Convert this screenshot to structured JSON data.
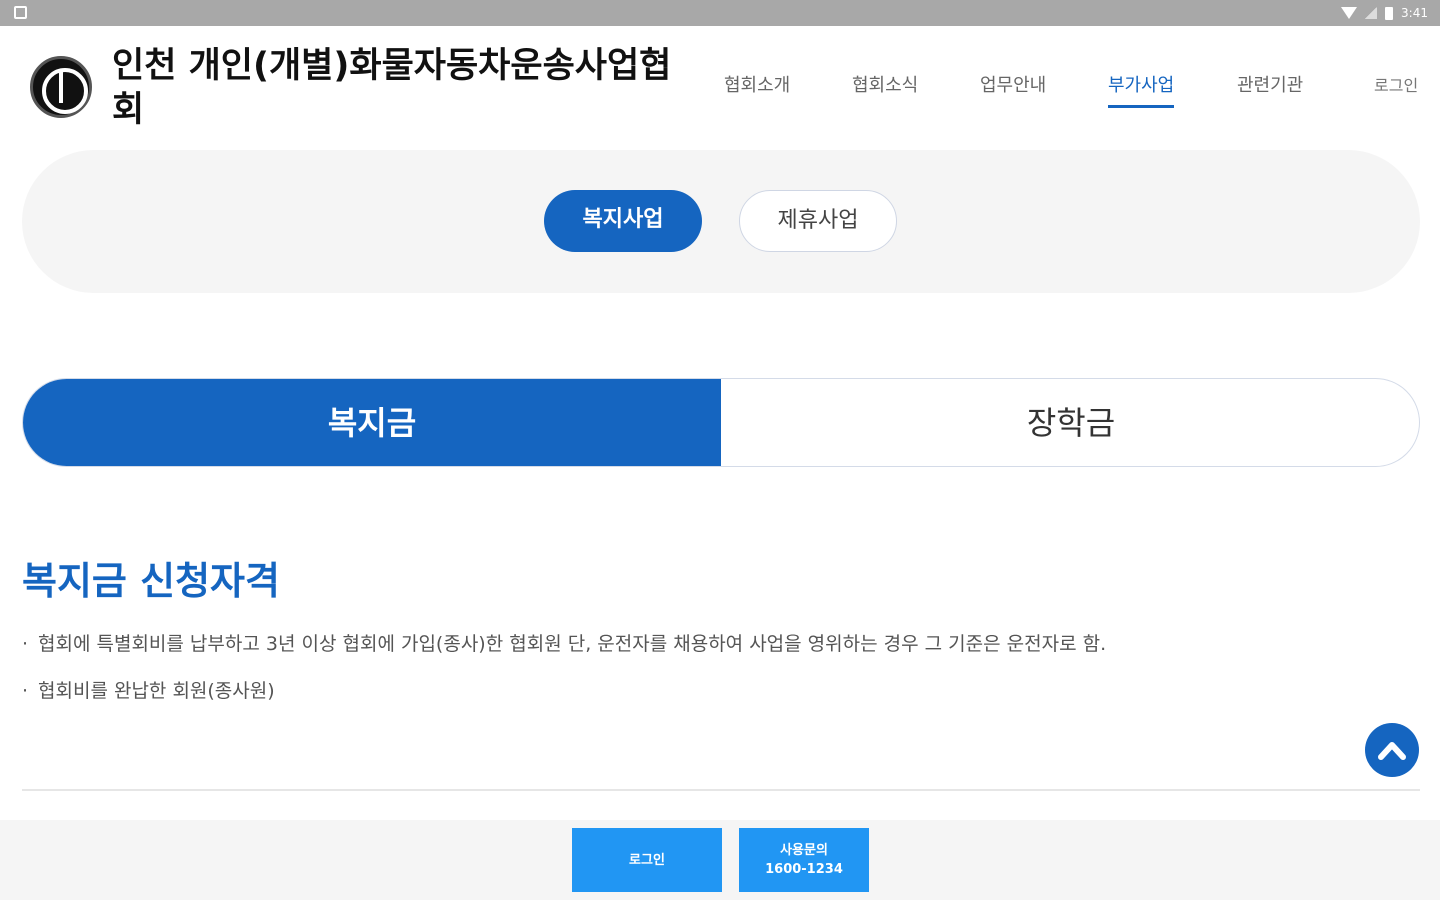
{
  "status_bar": {
    "time": "3:41",
    "icons": [
      "sim-card-icon",
      "wifi-icon",
      "signal-icon",
      "battery-icon"
    ]
  },
  "header": {
    "title": "인천 개인(개별)화물자동차운송사업협회",
    "logo_icon": "association-emblem-icon"
  },
  "nav": {
    "items": [
      {
        "label": "협회소개"
      },
      {
        "label": "협회소식"
      },
      {
        "label": "업무안내"
      },
      {
        "label": "부가사업"
      },
      {
        "label": "관련기관"
      }
    ],
    "active_index": 3,
    "login_label": "로그인"
  },
  "subnav": {
    "items": [
      "복지사업",
      "제휴사업"
    ],
    "active_index": 0
  },
  "tabs": {
    "items": [
      "복지금",
      "장학금"
    ],
    "active_index": 0
  },
  "content": {
    "title": "복지금 신청자격",
    "bullets": [
      "협회에 특별회비를 납부하고 3년 이상 협회에 가입(종사)한 협회원 단, 운전자를 채용하여 사업을 영위하는 경우 그 기준은 운전자로 함.",
      "협회비를 완납한 회원(종사원)"
    ]
  },
  "scroll_top": {
    "icon": "chevron-up-icon"
  },
  "footer": {
    "login_label": "로그인",
    "call_label_line1": "사용문의",
    "call_label_line2": "1600-1234"
  },
  "colors": {
    "primary": "#1565c0",
    "footer_button": "#2196f3",
    "panel_bg": "#f5f5f5",
    "statusbar_bg": "#a8a8a8"
  }
}
